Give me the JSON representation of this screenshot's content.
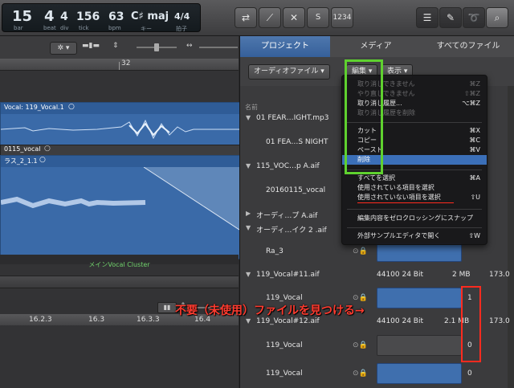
{
  "transport": {
    "bar": "15",
    "beat": "4",
    "div": "4",
    "tick": "156",
    "bar_label": "bar",
    "beat_label": "beat",
    "div_label": "div",
    "tick_label": "tick",
    "tempo": "63",
    "tempo_label": "bpm",
    "key": "C♯ maj",
    "key_label": "キー",
    "sig": "4/4",
    "sig_label": "拍子"
  },
  "arrange": {
    "marker": "32",
    "region1_label": "Vocal: 119_Vocal.1",
    "region2_header": "0115_vocal",
    "region3_label": "ラス_2_1.1",
    "cluster_label": "メインVocal Cluster",
    "timeline": [
      "16.2.3",
      "16.3",
      "16.3.3",
      "16.4"
    ]
  },
  "browser": {
    "tabs": [
      "プロジェクト",
      "メディア",
      "すべてのファイル"
    ],
    "btn_audio": "オーディオファイル ▾",
    "btn_edit": "編集 ▾",
    "btn_view": "表示 ▾",
    "col_name": "名前",
    "rows": [
      {
        "name": "01 FEAR…IGHT.mp3",
        "tri": "▼"
      },
      {
        "name": "01 FEA…S NIGHT",
        "tri": ""
      },
      {
        "name": "115_VOC…p A.aif",
        "tri": "▼"
      },
      {
        "name": "20160115_vocal",
        "tri": ""
      },
      {
        "name": "オーディ…プ A.aif",
        "tri": "▶"
      },
      {
        "name": "オーディ…イク 2 .aif",
        "tri": "▼"
      },
      {
        "name": "Ra_3",
        "tri": ""
      },
      {
        "name": "119_Vocal#11.aif",
        "tri": "▼",
        "info": "44100 24 Bit",
        "size": "2 MB",
        "val": "173.0"
      },
      {
        "name": "119_Vocal",
        "tri": "",
        "count": "1"
      },
      {
        "name": "119_Vocal#12.aif",
        "tri": "▼",
        "info": "44100 24 Bit",
        "size": "2.1 MB",
        "val": "173.0"
      },
      {
        "name": "119_Vocal",
        "tri": "",
        "count": "0"
      },
      {
        "name": "119_Vocal",
        "tri": "",
        "count": "0"
      }
    ]
  },
  "menu": {
    "items": [
      {
        "label": "取り消しできません",
        "shortcut": "⌘Z"
      },
      {
        "label": "やり直しできません",
        "shortcut": "⇧⌘Z"
      },
      {
        "label": "取り消し履歴...",
        "shortcut": "⌥⌘Z"
      },
      {
        "label": "取り消し履歴を削除",
        "shortcut": ""
      },
      {
        "label": "カット",
        "shortcut": "⌘X"
      },
      {
        "label": "コピー",
        "shortcut": "⌘C"
      },
      {
        "label": "ペースト",
        "shortcut": "⌘V"
      },
      {
        "label": "削除",
        "shortcut": ""
      },
      {
        "label": "すべてを選択",
        "shortcut": "⌘A"
      },
      {
        "label": "使用されている項目を選択",
        "shortcut": ""
      },
      {
        "label": "使用されていない項目を選択",
        "shortcut": "⇧U"
      },
      {
        "label": "編集内容をゼロクロッシングにスナップ",
        "shortcut": ""
      },
      {
        "label": "外部サンプルエディタで開く",
        "shortcut": "⇧W"
      }
    ]
  },
  "annotation": "不要（未使用）ファイルを見つける→",
  "colors": {
    "accent": "#3b6fb8",
    "highlight_green": "#5fd12f",
    "highlight_red": "#ff2b1f"
  }
}
